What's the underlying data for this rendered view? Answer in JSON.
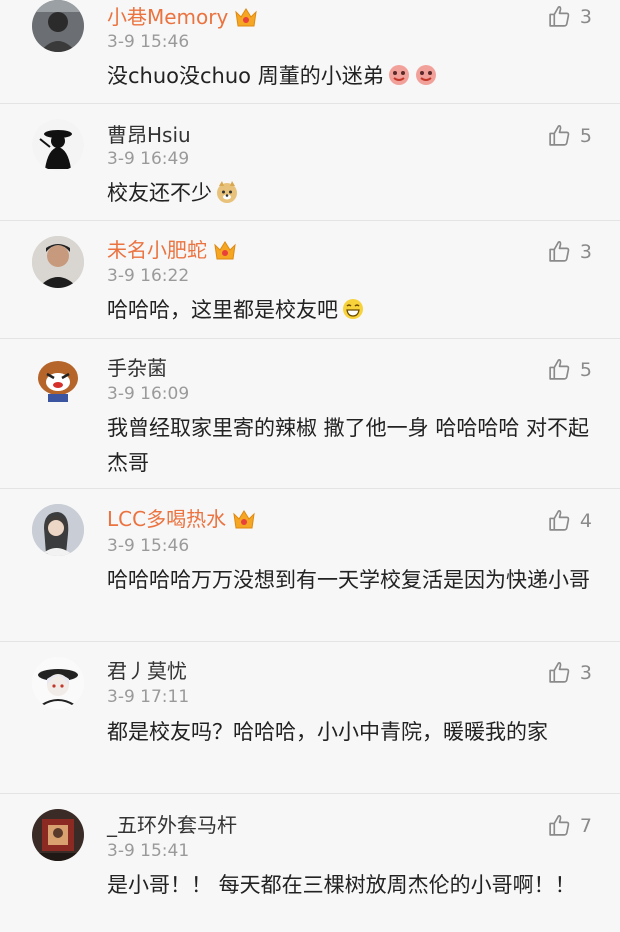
{
  "comments": [
    {
      "username": "小巷Memory",
      "vip": true,
      "time": "3-9 15:46",
      "text": "没chuo没chuo 周董的小迷弟",
      "emojis": [
        "face-icon",
        "face-icon"
      ],
      "likes": "3",
      "avatar": "avatar-photo-dark"
    },
    {
      "username": "曹昂Hsiu",
      "vip": false,
      "time": "3-9 16:49",
      "text": "校友还不少",
      "emojis": [
        "doge-icon"
      ],
      "likes": "5",
      "avatar": "avatar-silhouette"
    },
    {
      "username": "未名小肥蛇",
      "vip": true,
      "time": "3-9 16:22",
      "text": "哈哈哈，这里都是校友吧",
      "emojis": [
        "grin-icon"
      ],
      "likes": "3",
      "avatar": "avatar-man"
    },
    {
      "username": "手杂菌",
      "vip": false,
      "time": "3-9 16:09",
      "text": "我曾经取家里寄的辣椒 撒了他一身 哈哈哈哈 对不起杰哥",
      "emojis": [],
      "likes": "5",
      "avatar": "avatar-cartoon"
    },
    {
      "username": "LCC多喝热水",
      "vip": true,
      "time": "3-9 15:46",
      "text": "哈哈哈哈万万没想到有一天学校复活是因为快递小哥",
      "emojis": [],
      "likes": "4",
      "avatar": "avatar-girl"
    },
    {
      "username": "君丿莫忧",
      "vip": false,
      "time": "3-9 17:11",
      "text": "都是校友吗？哈哈哈，小小中青院，暖暖我的家",
      "emojis": [],
      "likes": "3",
      "avatar": "avatar-anime"
    },
    {
      "username": "_五环外套马杆",
      "vip": false,
      "time": "3-9 15:41",
      "text": "是小哥！！ 每天都在三棵树放周杰伦的小哥啊！！",
      "emojis": [],
      "likes": "7",
      "avatar": "avatar-dark-red"
    }
  ],
  "colors": {
    "vip_name": "#eb7340",
    "normal_name": "#333333",
    "time": "#9a9a9a",
    "divider": "#e4e4e4",
    "background": "#f7f7f7"
  }
}
